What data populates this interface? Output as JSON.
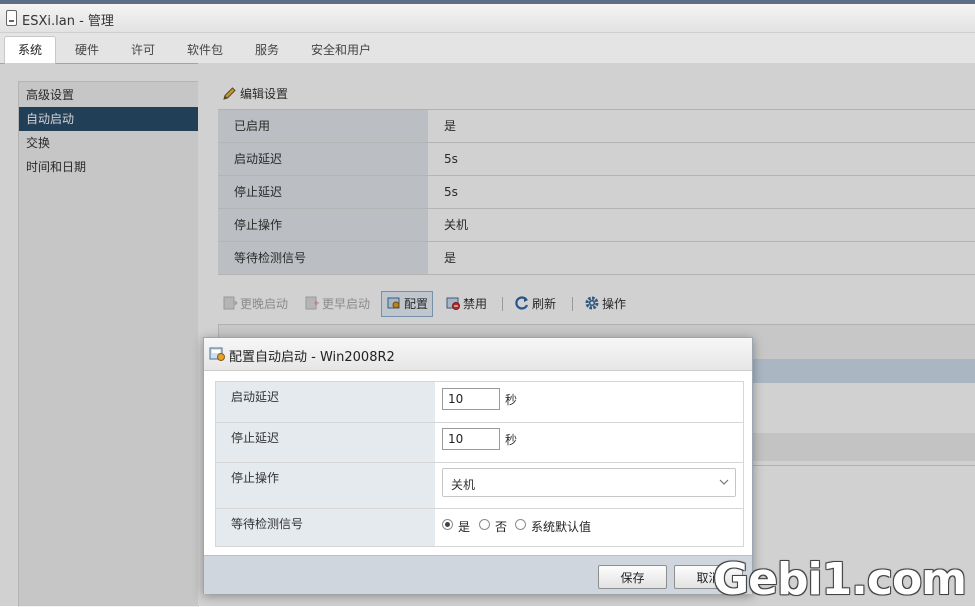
{
  "window": {
    "title": "ESXi.lan - 管理"
  },
  "tabs": [
    {
      "label": "系统",
      "active": true
    },
    {
      "label": "硬件"
    },
    {
      "label": "许可"
    },
    {
      "label": "软件包"
    },
    {
      "label": "服务"
    },
    {
      "label": "安全和用户"
    }
  ],
  "sidebar": {
    "items": [
      {
        "label": "高级设置"
      },
      {
        "label": "自动启动",
        "active": true
      },
      {
        "label": "交换"
      },
      {
        "label": "时间和日期"
      }
    ]
  },
  "content": {
    "edit_label": "编辑设置",
    "properties": [
      {
        "key": "已启用",
        "value": "是"
      },
      {
        "key": "启动延迟",
        "value": "5s"
      },
      {
        "key": "停止延迟",
        "value": "5s"
      },
      {
        "key": "停止操作",
        "value": "关机"
      },
      {
        "key": "等待检测信号",
        "value": "是"
      }
    ],
    "toolbar": {
      "later": "更晚启动",
      "earlier": "更早启动",
      "configure": "配置",
      "disable": "禁用",
      "refresh": "刷新",
      "actions": "操作"
    }
  },
  "dialog": {
    "title": "配置自动启动 - Win2008R2",
    "start_delay": {
      "label": "启动延迟",
      "value": "10",
      "unit": "秒"
    },
    "stop_delay": {
      "label": "停止延迟",
      "value": "10",
      "unit": "秒"
    },
    "stop_action": {
      "label": "停止操作",
      "value": "关机"
    },
    "heartbeat": {
      "label": "等待检测信号",
      "options": [
        "是",
        "否",
        "系统默认值"
      ],
      "selected": "是"
    },
    "save_label": "保存",
    "cancel_label": "取消"
  },
  "watermark": "Gebi1.com",
  "colors": {
    "accent": "#2a4d6c",
    "key_bg": "#e5eaef",
    "footer_bg": "#cfd6dd"
  }
}
